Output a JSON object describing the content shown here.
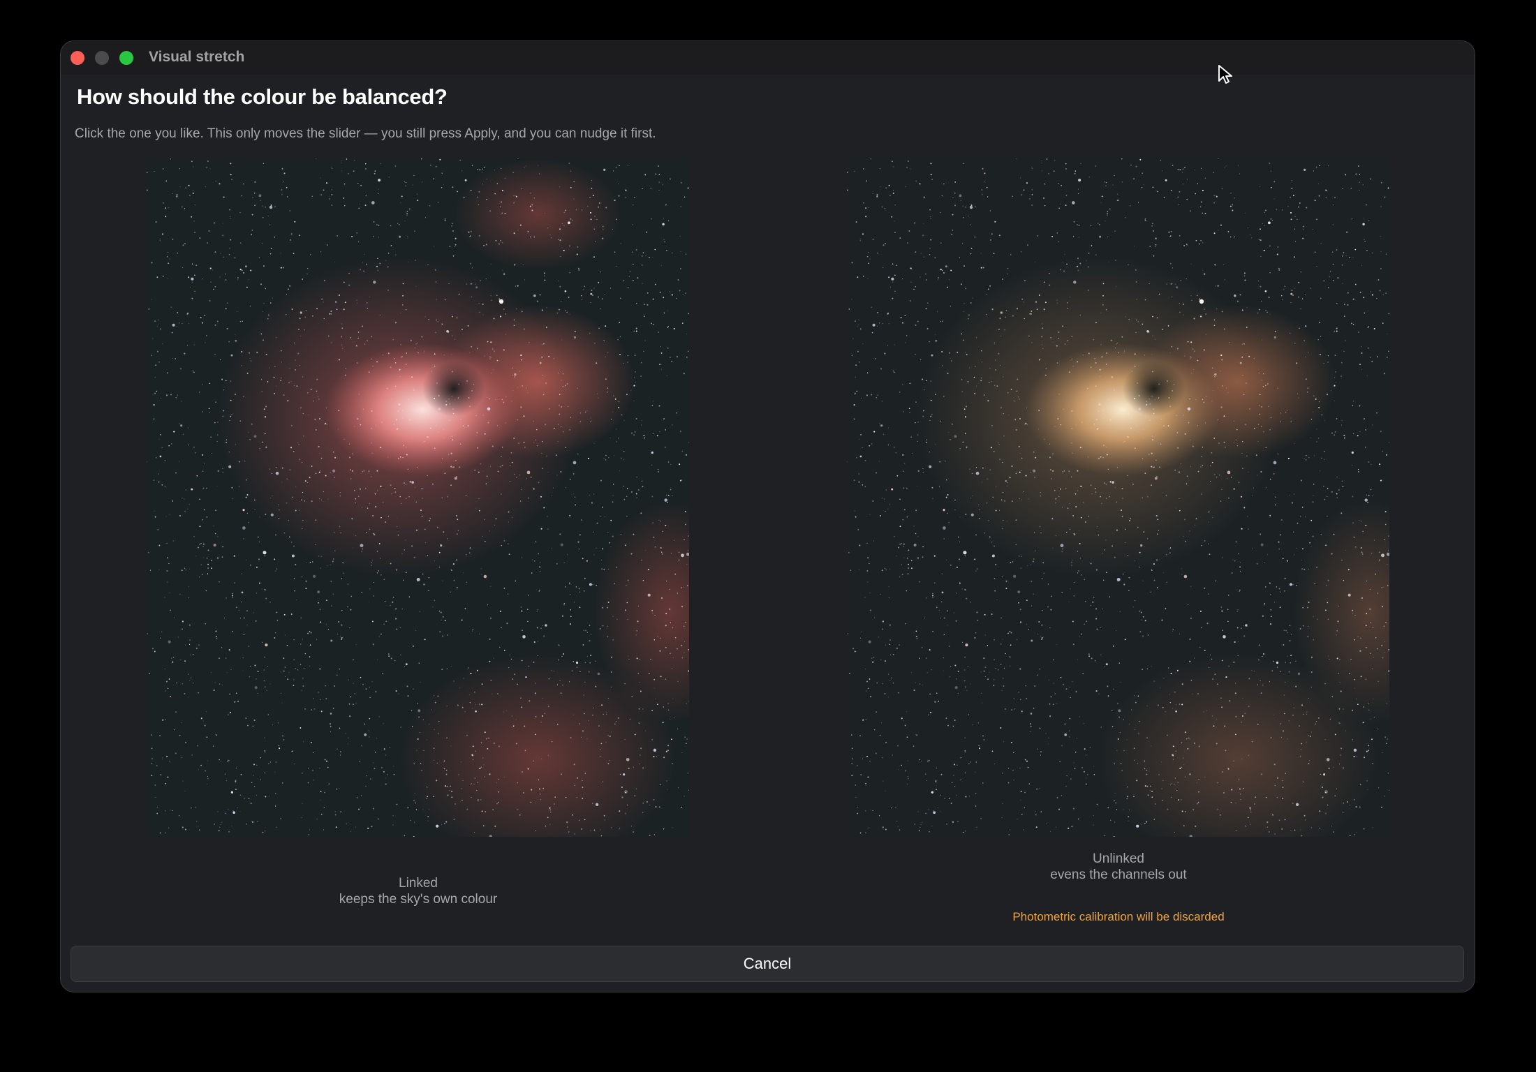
{
  "window": {
    "title": "Visual stretch"
  },
  "dialog": {
    "heading": "How should the colour be balanced?",
    "instructions": "Click the one you like. This only moves the slider — you still press Apply, and you can nudge it first."
  },
  "options": [
    {
      "name": "Linked",
      "description": "keeps the sky's own colour",
      "nebula_color": "#e86a6a",
      "core_color": "#f7d2cf"
    },
    {
      "name": "Unlinked",
      "description": "evens the channels out",
      "warning": "Photometric calibration will be discarded",
      "nebula_color": "#c9875a",
      "core_color": "#f6e2bf"
    }
  ],
  "cancel_label": "Cancel",
  "colors": {
    "warning": "#f2a43a",
    "close": "#fe5f57",
    "maximize": "#28c840"
  }
}
